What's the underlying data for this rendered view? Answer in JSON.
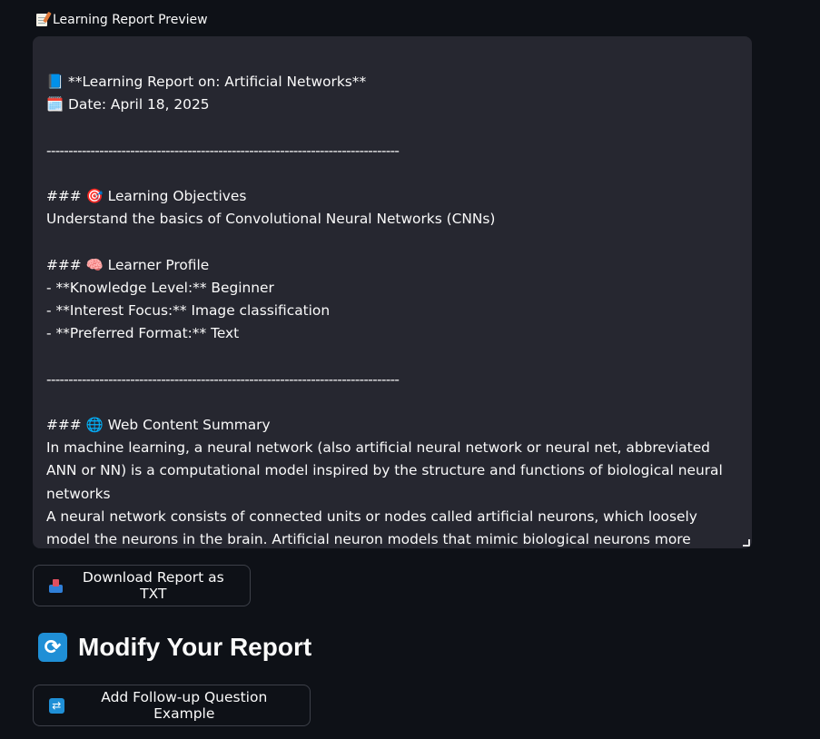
{
  "preview_label": {
    "icon": "memo-icon",
    "text": "Learning Report Preview"
  },
  "report_text": {
    "lines": [
      "📘 **Learning Report on: Artificial Networks**",
      "🗓️ Date: April 18, 2025",
      "",
      "--------------------------------------------------------------------------------",
      "",
      "### 🎯 Learning Objectives",
      "Understand the basics of Convolutional Neural Networks (CNNs)",
      "",
      "### 🧠 Learner Profile",
      "- **Knowledge Level:** Beginner",
      "- **Interest Focus:** Image classification",
      "- **Preferred Format:** Text",
      "",
      "--------------------------------------------------------------------------------",
      "",
      "### 🌐 Web Content Summary",
      "In machine learning, a neural network (also artificial neural network or neural net, abbreviated ANN or NN) is a computational model inspired by the structure and functions of biological neural networks",
      "A neural network consists of connected units or nodes called artificial neurons, which loosely model the neurons in the brain. Artificial neuron models that mimic biological neurons more closely have"
    ]
  },
  "download_button": {
    "icon": "inbox-tray-icon",
    "label": "Download Report as TXT"
  },
  "modify_heading": {
    "icon": "refresh-icon",
    "text": "Modify Your Report"
  },
  "followup_button": {
    "icon": "repeat-icon",
    "label": "Add Follow-up Question Example"
  }
}
